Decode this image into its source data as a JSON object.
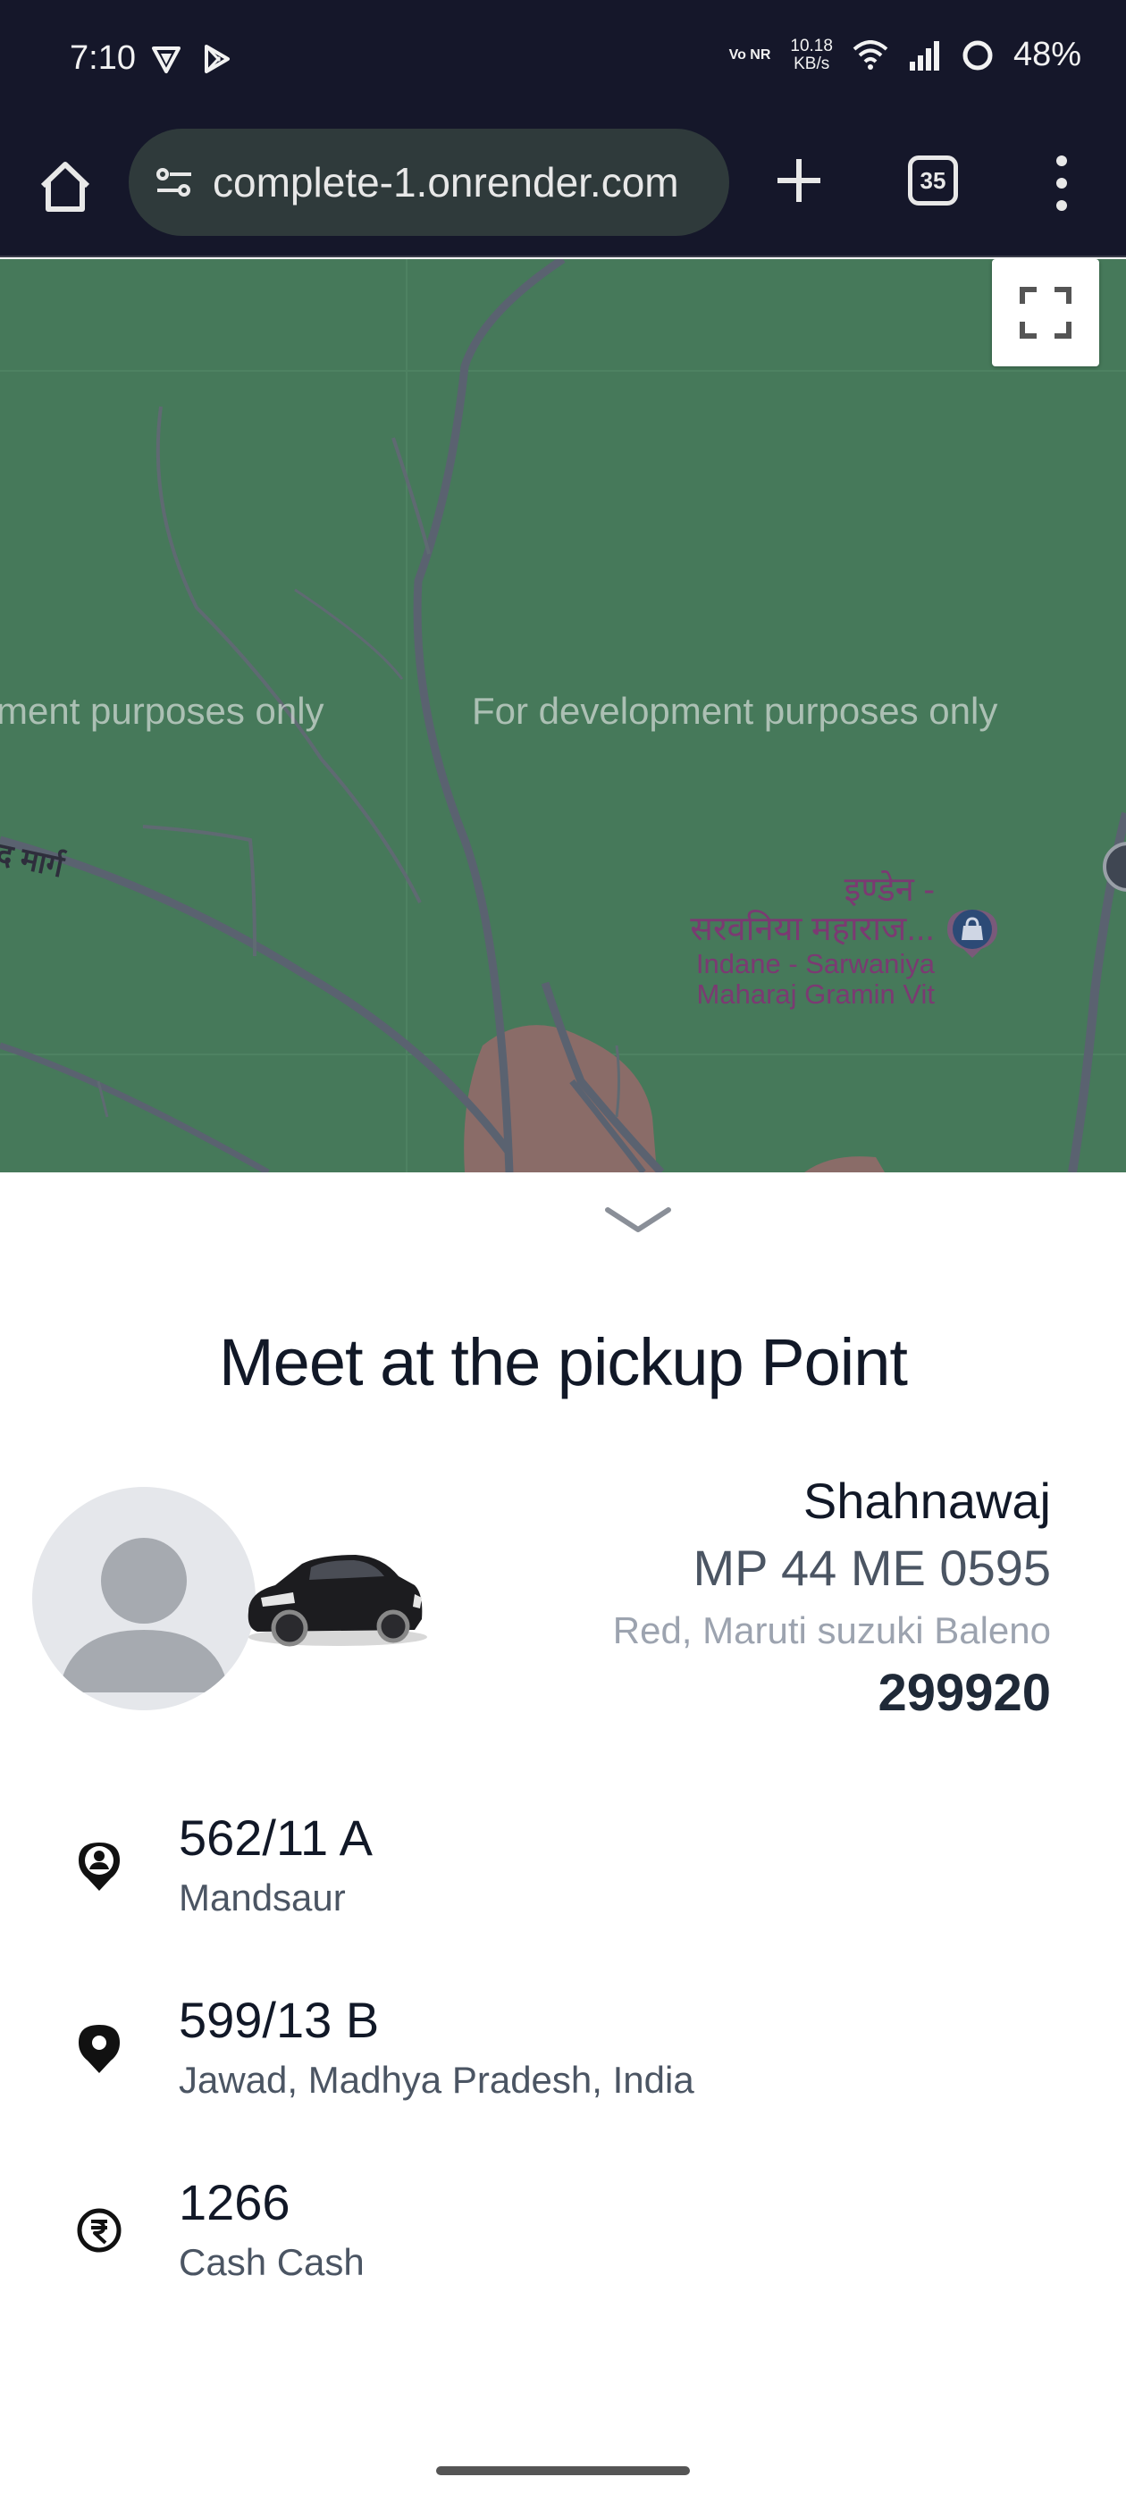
{
  "status_bar": {
    "time": "7:10",
    "network_label": "Vo NR",
    "speed_value": "10.18",
    "speed_unit": "KB/s",
    "battery": "48%"
  },
  "browser": {
    "url": "complete-1.onrender.com",
    "tab_count": "35"
  },
  "map": {
    "watermark_left": "ment purposes only",
    "watermark_right": "For development purposes only",
    "road_label": "द मार्ग",
    "poi_name_hi_line1": "इण्डेन -",
    "poi_name_hi_line2": "सरवनिया महाराज...",
    "poi_name_en_line1": "Indane - Sarwaniya",
    "poi_name_en_line2": "Maharaj Gramin Vit",
    "background_color": "#46795a"
  },
  "sheet": {
    "title": "Meet at the pickup Point",
    "driver": {
      "name": "Shahnawaj",
      "vehicle_number": "MP 44 ME 0595",
      "vehicle_description": "Red, Maruti suzuki Baleno",
      "otp": "299920"
    },
    "pickup": {
      "main": "562/11 A",
      "sub": "Mandsaur"
    },
    "drop": {
      "main": "599/13 B",
      "sub": "Jawad, Madhya Pradesh, India"
    },
    "fare": {
      "main": "1266",
      "sub": "Cash Cash"
    }
  }
}
